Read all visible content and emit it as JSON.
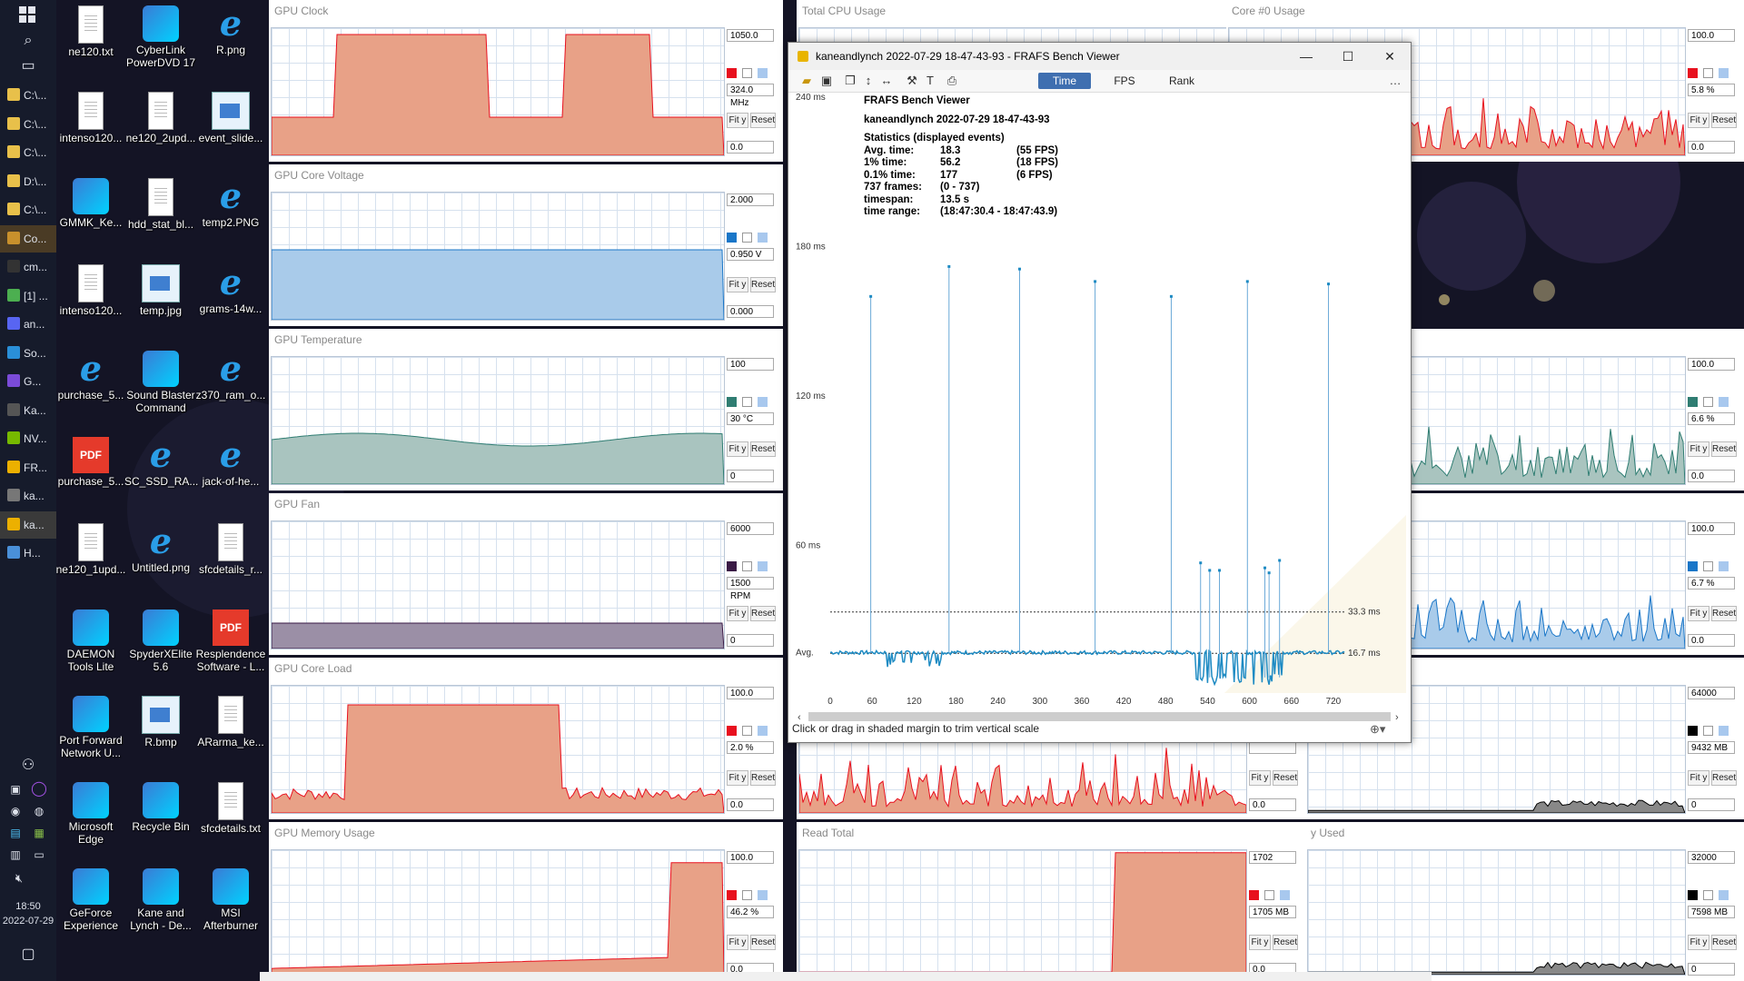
{
  "taskbar": {
    "items": [
      "C:\\...",
      "C:\\...",
      "C:\\...",
      "D:\\...",
      "C:\\...",
      "Co...",
      "cm...",
      "[1] ...",
      "an...",
      "So...",
      "G...",
      "Ka...",
      "NV...",
      "FR...",
      "ka...",
      "ka...",
      "H..."
    ],
    "clock_time": "18:50",
    "clock_date": "2022-07-29"
  },
  "desktop_icons": [
    {
      "label": "ne120.txt",
      "type": "txt"
    },
    {
      "label": "CyberLink PowerDVD 17",
      "type": "app"
    },
    {
      "label": "R.png",
      "type": "ie"
    },
    {
      "label": "intenso120...",
      "type": "txt"
    },
    {
      "label": "ne120_2upd...",
      "type": "txt"
    },
    {
      "label": "event_slide...",
      "type": "img"
    },
    {
      "label": "GMMK_Ke...",
      "type": "app"
    },
    {
      "label": "hdd_stat_bl...",
      "type": "txt"
    },
    {
      "label": "temp2.PNG",
      "type": "ie"
    },
    {
      "label": "intenso120...",
      "type": "txt"
    },
    {
      "label": "temp.jpg",
      "type": "img"
    },
    {
      "label": "grams-14w...",
      "type": "ie"
    },
    {
      "label": "purchase_5...",
      "type": "ie"
    },
    {
      "label": "Sound Blaster Command",
      "type": "app"
    },
    {
      "label": "z370_ram_o...",
      "type": "ie"
    },
    {
      "label": "purchase_5...",
      "type": "pdf"
    },
    {
      "label": "SC_SSD_RA...",
      "type": "ie"
    },
    {
      "label": "jack-of-he...",
      "type": "ie"
    },
    {
      "label": "ne120_1upd...",
      "type": "txt"
    },
    {
      "label": "Untitled.png",
      "type": "ie"
    },
    {
      "label": "sfcdetails_r...",
      "type": "txt"
    },
    {
      "label": "DAEMON Tools Lite",
      "type": "app"
    },
    {
      "label": "SpyderXElite 5.6",
      "type": "app"
    },
    {
      "label": "Resplendence Software - L...",
      "type": "pdf"
    },
    {
      "label": "Port Forward Network U...",
      "type": "app"
    },
    {
      "label": "R.bmp",
      "type": "img"
    },
    {
      "label": "ARarma_ke...",
      "type": "txt"
    },
    {
      "label": "Microsoft Edge",
      "type": "app"
    },
    {
      "label": "Recycle Bin",
      "type": "app"
    },
    {
      "label": "sfcdetails.txt",
      "type": "txt"
    },
    {
      "label": "GeForce Experience",
      "type": "app"
    },
    {
      "label": "Kane and Lynch - De...",
      "type": "app"
    },
    {
      "label": "MSI Afterburner",
      "type": "app"
    }
  ],
  "panels": [
    {
      "title": "GPU Clock",
      "max": "1050.0",
      "cur": "324.0 MHz",
      "min": "0.0",
      "color": "#e8a187",
      "swatch": "#e8101e"
    },
    {
      "title": "GPU Core Voltage",
      "max": "2.000",
      "cur": "0.950 V",
      "min": "0.000",
      "color": "#a9cbea",
      "swatch": "#1976c8"
    },
    {
      "title": "GPU Temperature",
      "max": "100",
      "cur": "30 °C",
      "min": "0",
      "color": "#a9c4bf",
      "swatch": "#2f7d72"
    },
    {
      "title": "GPU Fan",
      "max": "6000",
      "cur": "1500 RPM",
      "min": "0",
      "color": "#9b8fa6",
      "swatch": "#3a1a45"
    },
    {
      "title": "GPU Core Load",
      "max": "100.0",
      "cur": "2.0 %",
      "min": "0.0",
      "color": "#e8a187",
      "swatch": "#e8101e"
    },
    {
      "title": "GPU Memory Usage",
      "max": "100.0",
      "cur": "46.2 %",
      "min": "0.0",
      "color": "#e8a187",
      "swatch": "#e8101e"
    },
    {
      "title": "Total CPU Usage",
      "max": "",
      "cur": "",
      "min": "",
      "color": "#e8a187",
      "swatch": "#e8101e"
    },
    {
      "title": "Core #0 Usage",
      "max": "100.0",
      "cur": "5.8 %",
      "min": "0.0",
      "color": "#e8a187",
      "swatch": "#e8101e"
    },
    {
      "title": "",
      "max": "100.0",
      "cur": "6.6 %",
      "min": "0.0",
      "color": "#a9c4bf",
      "swatch": "#2f7d72"
    },
    {
      "title": "",
      "max": "100.0",
      "cur": "6.7 %",
      "min": "0.0",
      "color": "#a9cbea",
      "swatch": "#1976c8"
    },
    {
      "title": "",
      "max": "",
      "cur": "",
      "min": "0.0",
      "color": "#e8a187",
      "swatch": "#e8101e"
    },
    {
      "title": "",
      "max": "64000",
      "cur": "9432 MB",
      "min": "0",
      "color": "#888",
      "swatch": "#000"
    },
    {
      "title": "Read Total",
      "max": "1702",
      "cur": "1705 MB",
      "min": "0.0",
      "color": "#e8a187",
      "swatch": "#e8101e"
    },
    {
      "title": "y Used",
      "max": "32000",
      "cur": "7598 MB",
      "min": "0",
      "color": "#888",
      "swatch": "#000"
    }
  ],
  "panel_buttons": {
    "fit": "Fit y",
    "reset": "Reset"
  },
  "frafs": {
    "window_title": "kaneandlynch 2022-07-29 18-47-43-93 - FRAFS Bench Viewer",
    "tabs": [
      "Time",
      "FPS",
      "Rank"
    ],
    "active_tab": "Time",
    "heading": "FRAFS Bench Viewer",
    "run_name": "kaneandlynch 2022-07-29 18-47-43-93",
    "stats_title": "Statistics (displayed events)",
    "stats": [
      {
        "label": "Avg. time:",
        "value": "18.3",
        "extra": "(55 FPS)"
      },
      {
        "label": "1% time:",
        "value": "56.2",
        "extra": "(18 FPS)"
      },
      {
        "label": "0.1% time:",
        "value": "177",
        "extra": "(6 FPS)"
      },
      {
        "label": "737 frames:",
        "value": "(0 - 737)",
        "extra": ""
      },
      {
        "label": "timespan:",
        "value": "13.5 s",
        "extra": ""
      },
      {
        "label": "time range:",
        "value": "(18:47:30.4 - 18:47:43.9)",
        "extra": ""
      }
    ],
    "avg_label": "Avg.",
    "line_33_label": "33.3 ms",
    "line_16_label": "16.7 ms",
    "status_text": "Click or drag in shaded margin to trim vertical scale"
  },
  "chart_data": {
    "type": "line",
    "title": "",
    "xlabel": "",
    "ylabel": "",
    "y_unit": "ms",
    "yticks": [
      240,
      180,
      120,
      60
    ],
    "ylim": [
      0,
      240
    ],
    "xticks": [
      0,
      60,
      120,
      180,
      240,
      300,
      360,
      420,
      480,
      540,
      600,
      660,
      720
    ],
    "xlim": [
      0,
      737
    ],
    "reference_lines": [
      {
        "label": "33.3 ms",
        "value": 33.3
      },
      {
        "label": "16.7 ms",
        "value": 16.7
      }
    ],
    "spikes": [
      {
        "x": 58,
        "y": 160
      },
      {
        "x": 170,
        "y": 172
      },
      {
        "x": 271,
        "y": 171
      },
      {
        "x": 379,
        "y": 166
      },
      {
        "x": 488,
        "y": 160
      },
      {
        "x": 597,
        "y": 166
      },
      {
        "x": 713,
        "y": 165
      }
    ],
    "secondary_spikes": [
      {
        "x": 530,
        "y": 53
      },
      {
        "x": 543,
        "y": 50
      },
      {
        "x": 557,
        "y": 50
      },
      {
        "x": 622,
        "y": 51
      },
      {
        "x": 628,
        "y": 49
      },
      {
        "x": 643,
        "y": 54
      }
    ],
    "baseline_ms": 17
  }
}
